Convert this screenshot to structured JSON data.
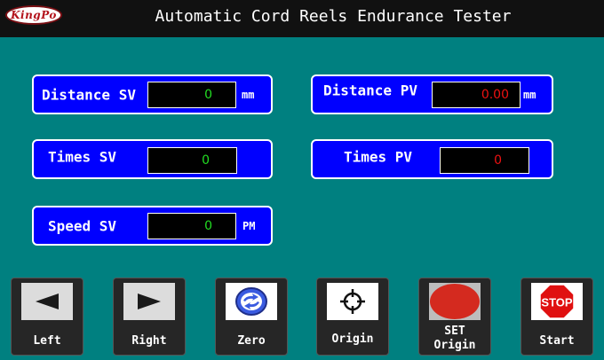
{
  "window": {
    "logo_text": "KingPo",
    "title": "Automatic Cord Reels Endurance Tester"
  },
  "panels": {
    "distance_sv": {
      "label": "Distance SV",
      "value": "0",
      "unit": "mm"
    },
    "distance_pv": {
      "label": "Distance PV",
      "value": "0.00",
      "unit": "mm"
    },
    "times_sv": {
      "label": "Times SV",
      "value": "0"
    },
    "times_pv": {
      "label": "Times PV",
      "value": "0"
    },
    "speed_sv": {
      "label": "Speed SV",
      "value": "0",
      "unit": "PM"
    }
  },
  "buttons": {
    "left": {
      "label": "Left",
      "icon": "left-arrow-icon"
    },
    "right": {
      "label": "Right",
      "icon": "right-arrow-icon"
    },
    "zero": {
      "label": "Zero",
      "icon": "reset-arrows-icon"
    },
    "origin": {
      "label": "Origin",
      "icon": "crosshair-icon"
    },
    "set_origin": {
      "label_line1": "SET",
      "label_line2": "Origin",
      "icon": "red-circle-icon"
    },
    "start": {
      "label": "Start",
      "icon": "stop-sign-icon",
      "icon_text": "STOP"
    }
  },
  "colors": {
    "background": "#008080",
    "panel": "#0000ff",
    "value_green": "#22dd22",
    "value_red": "#ee1111",
    "titlebar": "#111111",
    "button": "#262626"
  }
}
